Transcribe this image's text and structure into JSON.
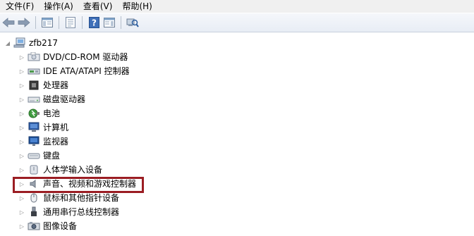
{
  "menubar": {
    "items": [
      "文件(F)",
      "操作(A)",
      "查看(V)",
      "帮助(H)"
    ]
  },
  "toolbar": {
    "buttons": [
      "back-icon",
      "forward-icon",
      "console-tree-icon",
      "properties-icon",
      "help-icon",
      "action-pane-icon",
      "scan-hardware-icon"
    ]
  },
  "tree": {
    "root": {
      "label": "zfb217",
      "expanded": true,
      "icon": "computer-icon"
    },
    "items": [
      {
        "label": "DVD/CD-ROM 驱动器",
        "icon": "dvd-drive-icon"
      },
      {
        "label": "IDE ATA/ATAPI 控制器",
        "icon": "ide-controller-icon"
      },
      {
        "label": "处理器",
        "icon": "processor-icon"
      },
      {
        "label": "磁盘驱动器",
        "icon": "disk-drive-icon"
      },
      {
        "label": "电池",
        "icon": "battery-icon"
      },
      {
        "label": "计算机",
        "icon": "computer-monitor-icon"
      },
      {
        "label": "监视器",
        "icon": "monitor-icon"
      },
      {
        "label": "键盘",
        "icon": "keyboard-icon"
      },
      {
        "label": "人体学输入设备",
        "icon": "hid-icon"
      },
      {
        "label": "声音、视频和游戏控制器",
        "icon": "speaker-icon",
        "highlighted": true
      },
      {
        "label": "鼠标和其他指针设备",
        "icon": "mouse-icon"
      },
      {
        "label": "通用串行总线控制器",
        "icon": "usb-icon"
      },
      {
        "label": "图像设备",
        "icon": "camera-icon"
      }
    ]
  },
  "colors": {
    "highlight_border": "#9b1d23",
    "expander": "#8d8d8d"
  }
}
